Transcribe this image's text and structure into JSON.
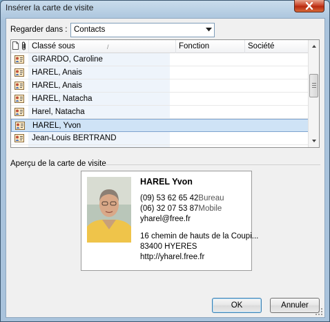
{
  "window": {
    "title": "Insérer la carte de visite"
  },
  "lookin": {
    "label": "Regarder dans :",
    "value": "Contacts"
  },
  "list": {
    "columns": [
      {
        "label": "Classé sous",
        "sort_indicator": "/"
      },
      {
        "label": "Fonction"
      },
      {
        "label": "Société"
      }
    ],
    "rows": [
      {
        "name": "GIRARDO, Caroline",
        "selected": false
      },
      {
        "name": "HAREL, Anais",
        "selected": false
      },
      {
        "name": "HAREL, Anais",
        "selected": false
      },
      {
        "name": "HAREL, Natacha",
        "selected": false
      },
      {
        "name": "Harel, Natacha",
        "selected": false
      },
      {
        "name": "HAREL, Yvon",
        "selected": true
      },
      {
        "name": "Jean-Louis BERTRAND",
        "selected": false
      }
    ]
  },
  "preview": {
    "label": "Aperçu de la carte de visite",
    "card": {
      "name": "HAREL Yvon",
      "phone1": "(09) 53 62 65 42",
      "phone1_type": "Bureau",
      "phone2": "(06) 32 07 53 87",
      "phone2_type": "Mobile",
      "email": "yharel@free.fr",
      "address1": "16 chemin de hauts de la Coupi...",
      "address2": "83400  HYERES",
      "website": "http://yharel.free.fr"
    }
  },
  "buttons": {
    "ok": "OK",
    "cancel": "Annuler"
  },
  "colors": {
    "selection": "#cfe3f6",
    "title_bar": "#b3cbe1",
    "close_button": "#c9452a"
  }
}
